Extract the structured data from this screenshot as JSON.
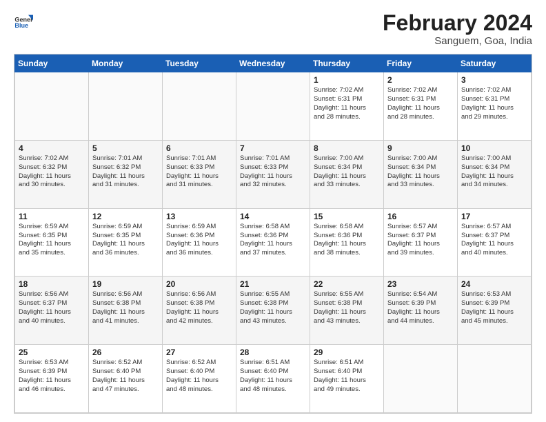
{
  "logo": {
    "text_general": "General",
    "text_blue": "Blue"
  },
  "header": {
    "title": "February 2024",
    "subtitle": "Sanguem, Goa, India"
  },
  "weekdays": [
    "Sunday",
    "Monday",
    "Tuesday",
    "Wednesday",
    "Thursday",
    "Friday",
    "Saturday"
  ],
  "weeks": [
    [
      {
        "day": "",
        "info": ""
      },
      {
        "day": "",
        "info": ""
      },
      {
        "day": "",
        "info": ""
      },
      {
        "day": "",
        "info": ""
      },
      {
        "day": "1",
        "info": "Sunrise: 7:02 AM\nSunset: 6:31 PM\nDaylight: 11 hours\nand 28 minutes."
      },
      {
        "day": "2",
        "info": "Sunrise: 7:02 AM\nSunset: 6:31 PM\nDaylight: 11 hours\nand 28 minutes."
      },
      {
        "day": "3",
        "info": "Sunrise: 7:02 AM\nSunset: 6:31 PM\nDaylight: 11 hours\nand 29 minutes."
      }
    ],
    [
      {
        "day": "4",
        "info": "Sunrise: 7:02 AM\nSunset: 6:32 PM\nDaylight: 11 hours\nand 30 minutes."
      },
      {
        "day": "5",
        "info": "Sunrise: 7:01 AM\nSunset: 6:32 PM\nDaylight: 11 hours\nand 31 minutes."
      },
      {
        "day": "6",
        "info": "Sunrise: 7:01 AM\nSunset: 6:33 PM\nDaylight: 11 hours\nand 31 minutes."
      },
      {
        "day": "7",
        "info": "Sunrise: 7:01 AM\nSunset: 6:33 PM\nDaylight: 11 hours\nand 32 minutes."
      },
      {
        "day": "8",
        "info": "Sunrise: 7:00 AM\nSunset: 6:34 PM\nDaylight: 11 hours\nand 33 minutes."
      },
      {
        "day": "9",
        "info": "Sunrise: 7:00 AM\nSunset: 6:34 PM\nDaylight: 11 hours\nand 33 minutes."
      },
      {
        "day": "10",
        "info": "Sunrise: 7:00 AM\nSunset: 6:34 PM\nDaylight: 11 hours\nand 34 minutes."
      }
    ],
    [
      {
        "day": "11",
        "info": "Sunrise: 6:59 AM\nSunset: 6:35 PM\nDaylight: 11 hours\nand 35 minutes."
      },
      {
        "day": "12",
        "info": "Sunrise: 6:59 AM\nSunset: 6:35 PM\nDaylight: 11 hours\nand 36 minutes."
      },
      {
        "day": "13",
        "info": "Sunrise: 6:59 AM\nSunset: 6:36 PM\nDaylight: 11 hours\nand 36 minutes."
      },
      {
        "day": "14",
        "info": "Sunrise: 6:58 AM\nSunset: 6:36 PM\nDaylight: 11 hours\nand 37 minutes."
      },
      {
        "day": "15",
        "info": "Sunrise: 6:58 AM\nSunset: 6:36 PM\nDaylight: 11 hours\nand 38 minutes."
      },
      {
        "day": "16",
        "info": "Sunrise: 6:57 AM\nSunset: 6:37 PM\nDaylight: 11 hours\nand 39 minutes."
      },
      {
        "day": "17",
        "info": "Sunrise: 6:57 AM\nSunset: 6:37 PM\nDaylight: 11 hours\nand 40 minutes."
      }
    ],
    [
      {
        "day": "18",
        "info": "Sunrise: 6:56 AM\nSunset: 6:37 PM\nDaylight: 11 hours\nand 40 minutes."
      },
      {
        "day": "19",
        "info": "Sunrise: 6:56 AM\nSunset: 6:38 PM\nDaylight: 11 hours\nand 41 minutes."
      },
      {
        "day": "20",
        "info": "Sunrise: 6:56 AM\nSunset: 6:38 PM\nDaylight: 11 hours\nand 42 minutes."
      },
      {
        "day": "21",
        "info": "Sunrise: 6:55 AM\nSunset: 6:38 PM\nDaylight: 11 hours\nand 43 minutes."
      },
      {
        "day": "22",
        "info": "Sunrise: 6:55 AM\nSunset: 6:38 PM\nDaylight: 11 hours\nand 43 minutes."
      },
      {
        "day": "23",
        "info": "Sunrise: 6:54 AM\nSunset: 6:39 PM\nDaylight: 11 hours\nand 44 minutes."
      },
      {
        "day": "24",
        "info": "Sunrise: 6:53 AM\nSunset: 6:39 PM\nDaylight: 11 hours\nand 45 minutes."
      }
    ],
    [
      {
        "day": "25",
        "info": "Sunrise: 6:53 AM\nSunset: 6:39 PM\nDaylight: 11 hours\nand 46 minutes."
      },
      {
        "day": "26",
        "info": "Sunrise: 6:52 AM\nSunset: 6:40 PM\nDaylight: 11 hours\nand 47 minutes."
      },
      {
        "day": "27",
        "info": "Sunrise: 6:52 AM\nSunset: 6:40 PM\nDaylight: 11 hours\nand 48 minutes."
      },
      {
        "day": "28",
        "info": "Sunrise: 6:51 AM\nSunset: 6:40 PM\nDaylight: 11 hours\nand 48 minutes."
      },
      {
        "day": "29",
        "info": "Sunrise: 6:51 AM\nSunset: 6:40 PM\nDaylight: 11 hours\nand 49 minutes."
      },
      {
        "day": "",
        "info": ""
      },
      {
        "day": "",
        "info": ""
      }
    ]
  ]
}
